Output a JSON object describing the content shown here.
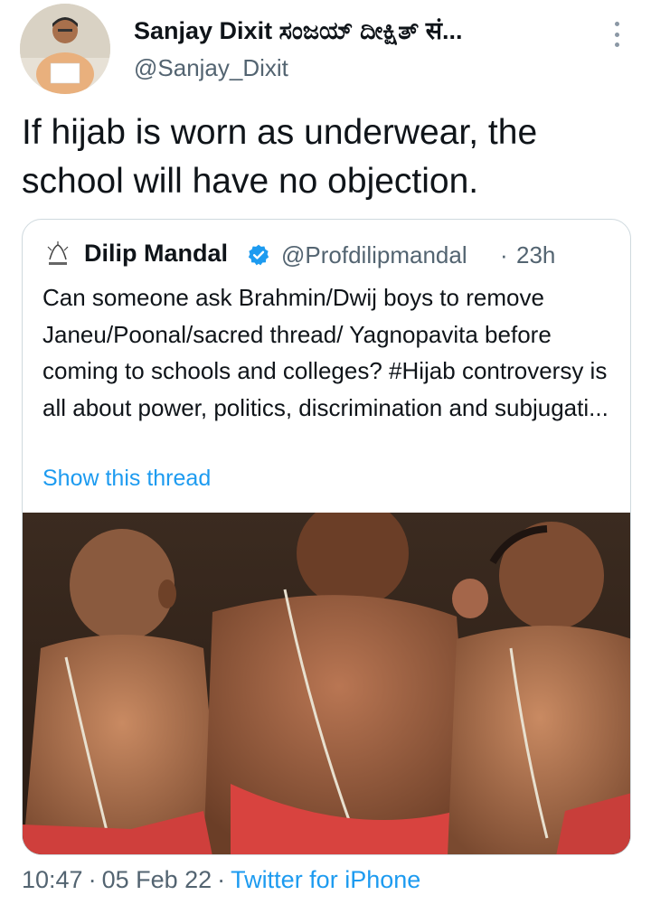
{
  "tweet": {
    "author_name": "Sanjay Dixit ಸಂಜಯ್ ದೀಕ್ಷಿತ್ सं...",
    "author_handle": "@Sanjay_Dixit",
    "text": "If hijab is worn as underwear, the school will have no objection.",
    "time": "10:47",
    "date": "05 Feb 22",
    "separator": "·",
    "source": "Twitter for iPhone"
  },
  "quoted": {
    "author_name": "Dilip Mandal",
    "verified": true,
    "handle": "@Profdilipmandal",
    "separator": "·",
    "time_ago": "23h",
    "text": "Can someone ask Brahmin/Dwij boys to remove Janeu/Poonal/sacred thread/ Yagnopavita before coming to schools and colleges? #Hijab controversy is all about power, politics, discrimination and subjugati...",
    "show_thread": "Show this thread",
    "media_description_icon": "photo-of-three-boys-with-sacred-thread"
  },
  "colors": {
    "link": "#1d9bf0",
    "secondary_text": "#536471",
    "border": "#cfd9de"
  }
}
